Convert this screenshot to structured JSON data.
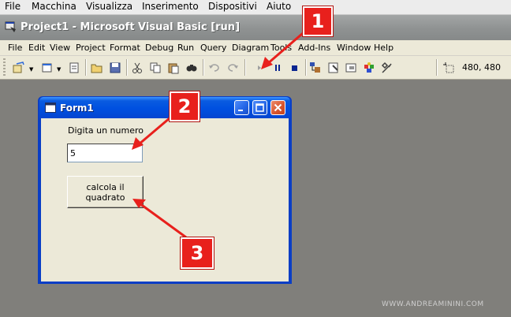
{
  "vm_menu": [
    "File",
    "Macchina",
    "Visualizza",
    "Inserimento",
    "Dispositivi",
    "Aiuto"
  ],
  "app": {
    "title": "Project1 - Microsoft Visual Basic [run]"
  },
  "vb_menu": [
    "File",
    "Edit",
    "View",
    "Project",
    "Format",
    "Debug",
    "Run",
    "Query",
    "Diagram",
    "Tools",
    "Add-Ins",
    "Window",
    "Help"
  ],
  "toolbar": {
    "icons": [
      "add-project-icon",
      "add-form-icon",
      "menu-editor-icon",
      "open-project-icon",
      "save-project-icon",
      "cut-icon",
      "copy-icon",
      "paste-icon",
      "find-icon",
      "undo-icon",
      "redo-icon",
      "start-icon",
      "break-icon",
      "end-icon",
      "project-explorer-icon",
      "properties-window-icon",
      "form-layout-icon",
      "object-browser-icon",
      "toolbox-icon",
      "position-icon"
    ],
    "coordinates": "480, 480"
  },
  "form": {
    "title": "Form1",
    "label": "Digita un numero",
    "input_value": "5",
    "button_label": "calcola il quadrato"
  },
  "callouts": [
    "1",
    "2",
    "3"
  ],
  "callout_color": "#e8201c",
  "watermark": "WWW.ANDREAMININI.COM"
}
